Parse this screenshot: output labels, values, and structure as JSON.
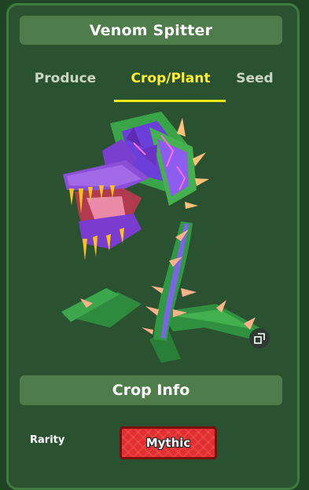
{
  "header": {
    "title": "Venom Spitter"
  },
  "tabs": [
    {
      "label": "Produce",
      "active": false
    },
    {
      "label": "Crop/Plant",
      "active": true
    },
    {
      "label": "Seed",
      "active": false
    }
  ],
  "preview": {
    "image": "venom-spitter-plant",
    "zoom_icon": "expand-icon"
  },
  "info": {
    "section_title": "Crop Info",
    "rarity_label": "Rarity",
    "rarity_value": "Mythic"
  },
  "colors": {
    "accent_tab": "#ffef2e",
    "panel_bg": "#2b5230",
    "bar_bg": "#4f7c4b",
    "mythic_red": "#e12e2e"
  }
}
